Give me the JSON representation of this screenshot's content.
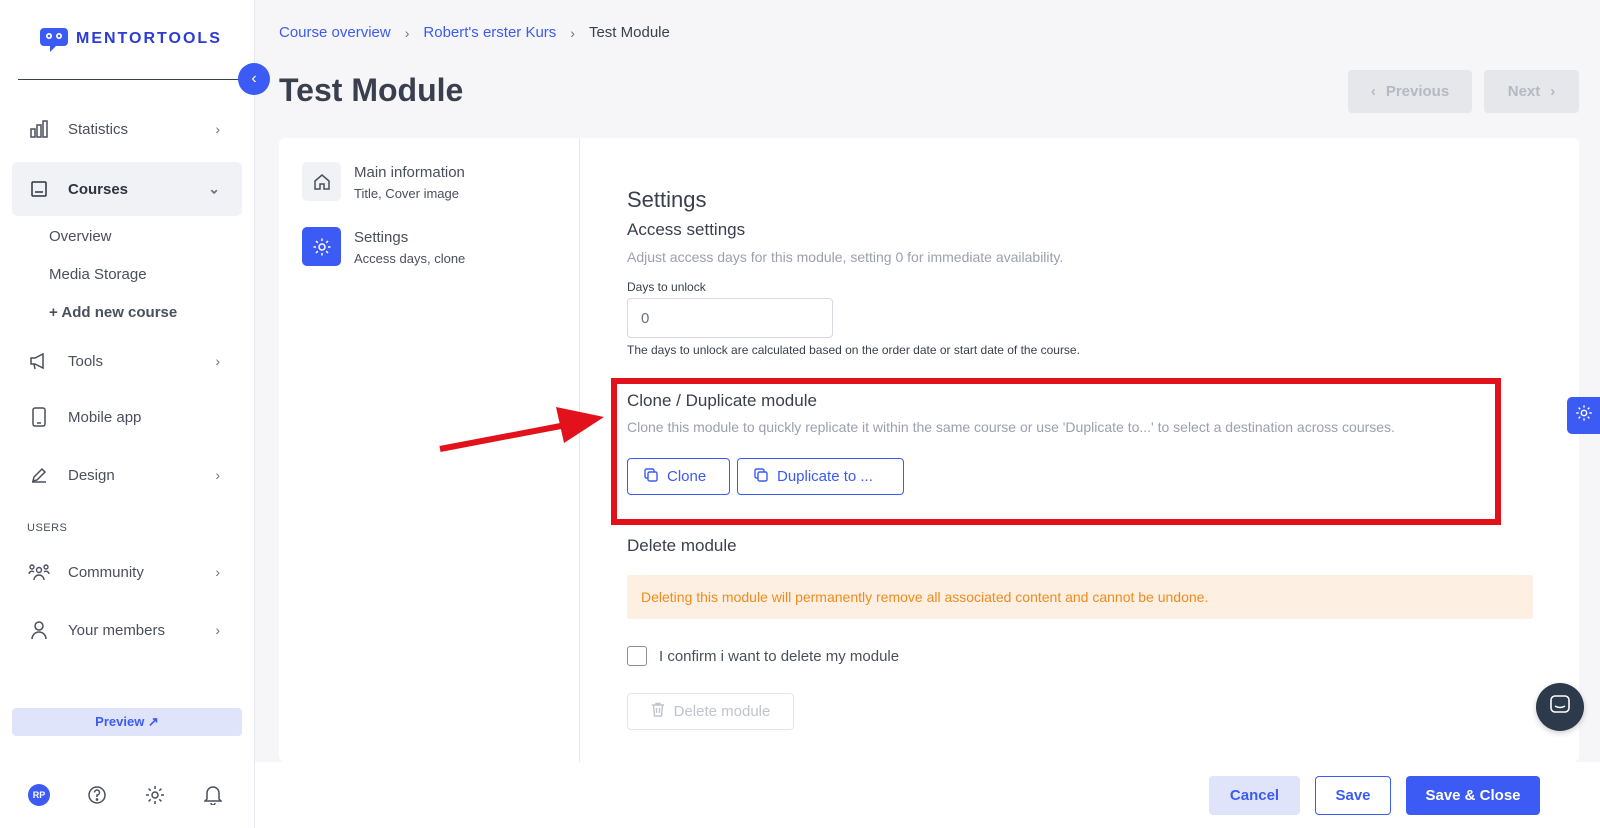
{
  "app": {
    "brand": "MENTORTOOLS",
    "accent": "#3b5bf4"
  },
  "sidebar": {
    "items": [
      {
        "label": "Statistics",
        "icon": "bar-chart-icon"
      },
      {
        "label": "Courses",
        "icon": "book-icon"
      },
      {
        "label": "Tools",
        "icon": "megaphone-icon"
      },
      {
        "label": "Mobile app",
        "icon": "phone-icon"
      },
      {
        "label": "Design",
        "icon": "pencil-icon"
      },
      {
        "label": "Community",
        "icon": "community-icon"
      },
      {
        "label": "Your members",
        "icon": "user-icon"
      }
    ],
    "course_sub": [
      "Overview",
      "Media Storage",
      "+ Add new course"
    ],
    "section_users": "USERS",
    "preview": "Preview ↗",
    "avatar_initials": "RP"
  },
  "breadcrumb": {
    "items": [
      "Course overview",
      "Robert's erster Kurs",
      "Test Module"
    ]
  },
  "page": {
    "title": "Test Module",
    "previous": "Previous",
    "next": "Next"
  },
  "tabs": [
    {
      "title": "Main information",
      "sub": "Title, Cover image"
    },
    {
      "title": "Settings",
      "sub": "Access days, clone"
    }
  ],
  "settings": {
    "title": "Settings",
    "access_title": "Access settings",
    "access_desc": "Adjust access days for this module, setting 0 for immediate availability.",
    "days_label": "Days to unlock",
    "days_value": "0",
    "days_hint": "The days to unlock are calculated based on the order date or start date of the course.",
    "clone_title": "Clone / Duplicate module",
    "clone_desc": "Clone this module to quickly replicate it within the same course or use 'Duplicate to...' to select a destination across courses.",
    "clone_btn": "Clone",
    "duplicate_btn": "Duplicate to ...",
    "delete_title": "Delete module",
    "delete_warning": "Deleting this module will permanently remove all associated content and cannot be undone.",
    "confirm_label": "I confirm i want to delete my module",
    "delete_btn": "Delete module"
  },
  "footer": {
    "cancel": "Cancel",
    "save": "Save",
    "save_close": "Save & Close"
  }
}
